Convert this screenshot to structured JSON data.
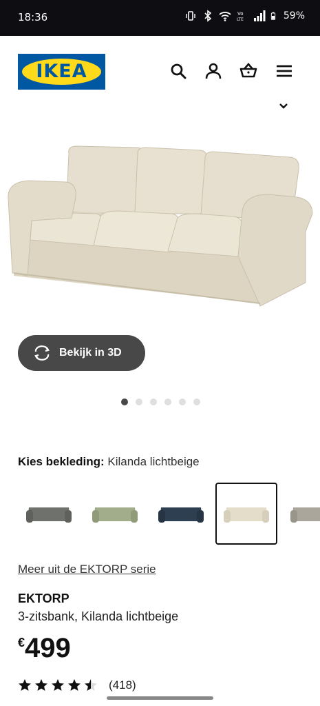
{
  "status_bar": {
    "time": "18:36",
    "battery": "59%"
  },
  "header": {
    "logo_text": "IKEA",
    "icons": [
      "search-icon",
      "profile-icon",
      "basket-icon",
      "menu-icon"
    ]
  },
  "product_image": {
    "view_3d_label": "Bekijk in 3D",
    "gallery_count": 6,
    "gallery_active": 1
  },
  "upholstery": {
    "label": "Kies bekleding:",
    "value": "Kilanda lichtbeige",
    "options": [
      {
        "color": "#6f716c",
        "selected": false
      },
      {
        "color": "#a2ad8c",
        "selected": false
      },
      {
        "color": "#2f3f52",
        "selected": false
      },
      {
        "color": "#e4ddc9",
        "selected": true
      },
      {
        "color": "#aaa69c",
        "selected": false
      }
    ]
  },
  "series_link": "Meer uit de EKTORP serie",
  "product": {
    "name": "EKTORP",
    "description": "3-zitsbank, Kilanda lichtbeige",
    "currency": "€",
    "price": "499",
    "rating_value": 4.5,
    "rating_count": "(418)"
  },
  "colors": {
    "ikea_blue": "#0058a3",
    "ikea_yellow": "#ffda1a",
    "button_dark": "#484848"
  }
}
